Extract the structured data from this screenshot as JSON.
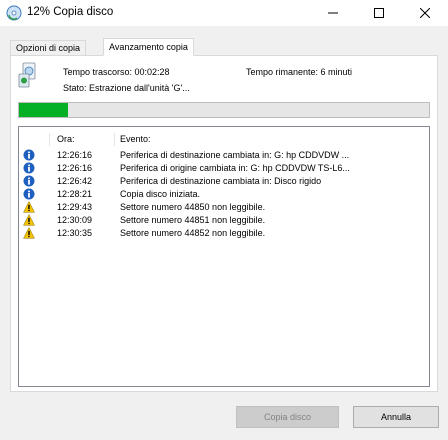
{
  "window": {
    "title": "12% Copia disco"
  },
  "tabs": [
    {
      "label": "Opzioni di copia",
      "active": false
    },
    {
      "label": "Avanzamento copia",
      "active": true
    }
  ],
  "status": {
    "elapsed": "Tempo trascorso: 00:02:28",
    "remaining": "Tempo rimanente: 6 minuti",
    "state": "Stato: Estrazione dall'unità 'G'..."
  },
  "progress": {
    "fraction": 0.12,
    "color": "#06b025"
  },
  "log": {
    "headers": {
      "time": "Ora:",
      "event": "Evento:"
    },
    "rows": [
      {
        "icon": "info-icon",
        "time": "12:26:16",
        "event": "Periferica di destinazione cambiata in: G: hp CDDVDW ..."
      },
      {
        "icon": "info-icon",
        "time": "12:26:16",
        "event": "Periferica di origine cambiata in: G: hp CDDVDW TS-L6..."
      },
      {
        "icon": "info-icon",
        "time": "12:26:42",
        "event": "Periferica di destinazione cambiata in: Disco rigido"
      },
      {
        "icon": "info-icon",
        "time": "12:28:21",
        "event": "Copia disco iniziata."
      },
      {
        "icon": "warning-icon",
        "time": "12:29:43",
        "event": "Settore numero 44850 non leggibile."
      },
      {
        "icon": "warning-icon",
        "time": "12:30:09",
        "event": "Settore numero 44851 non leggibile."
      },
      {
        "icon": "warning-icon",
        "time": "12:30:35",
        "event": "Settore numero 44852 non leggibile."
      }
    ]
  },
  "buttons": {
    "copy": "Copia disco",
    "cancel": "Annulla"
  }
}
